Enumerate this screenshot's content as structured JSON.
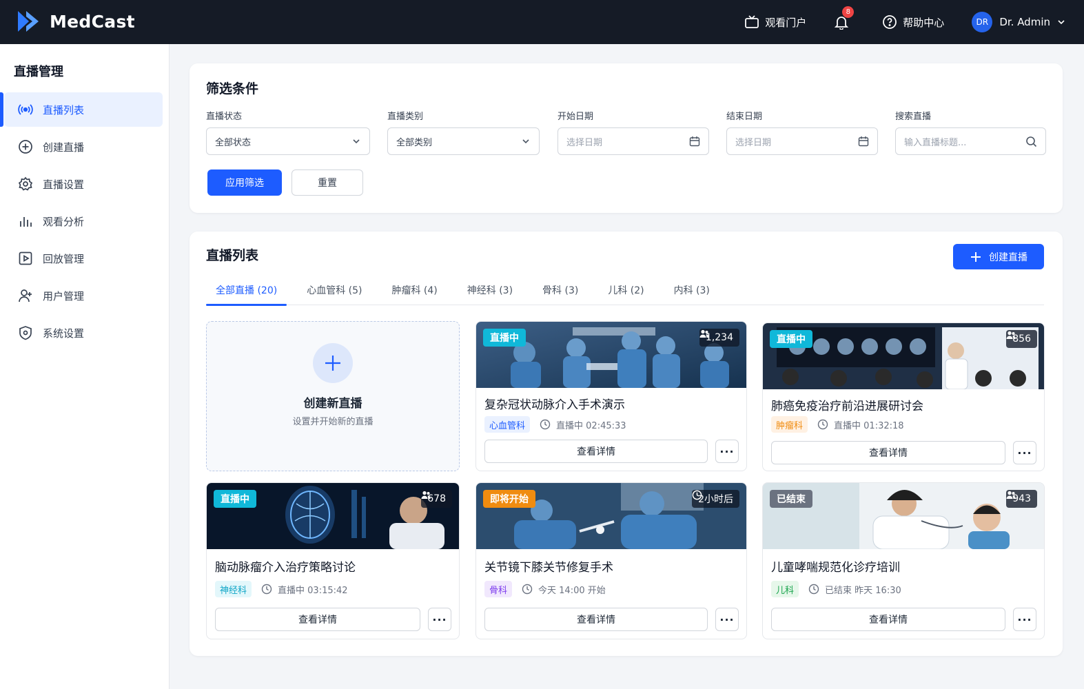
{
  "app": {
    "name": "MedCast"
  },
  "topbar": {
    "portal": "观看门户",
    "notifications": "8",
    "help": "帮助中心",
    "avatar": "DR",
    "user": "Dr. Admin"
  },
  "sidebar": {
    "title": "直播管理",
    "items": [
      {
        "label": "直播列表"
      },
      {
        "label": "创建直播"
      },
      {
        "label": "直播设置"
      },
      {
        "label": "观看分析"
      },
      {
        "label": "回放管理"
      },
      {
        "label": "用户管理"
      },
      {
        "label": "系统设置"
      }
    ]
  },
  "filters": {
    "title": "筛选条件",
    "status_label": "直播状态",
    "status_value": "全部状态",
    "category_label": "直播类别",
    "category_value": "全部类别",
    "start_label": "开始日期",
    "start_placeholder": "选择日期",
    "end_label": "结束日期",
    "end_placeholder": "选择日期",
    "search_label": "搜索直播",
    "search_placeholder": "输入直播标题...",
    "apply": "应用筛选",
    "reset": "重置"
  },
  "list": {
    "title": "直播列表",
    "create_button": "创建直播",
    "tabs": [
      {
        "label": "全部直播 (20)"
      },
      {
        "label": "心血管科 (5)"
      },
      {
        "label": "肿瘤科 (4)"
      },
      {
        "label": "神经科 (3)"
      },
      {
        "label": "骨科 (3)"
      },
      {
        "label": "儿科 (2)"
      },
      {
        "label": "内科 (3)"
      }
    ],
    "create_tile": {
      "title": "创建新直播",
      "subtitle": "设置并开始新的直播"
    },
    "detail_label": "查看详情",
    "more_label": "···",
    "streams": [
      {
        "status": "直播中",
        "viewers": "1,234",
        "title": "复杂冠状动脉介入手术演示",
        "dept": "心血管科",
        "time": "直播中 02:45:33"
      },
      {
        "status": "直播中",
        "viewers": "856",
        "title": "肺癌免疫治疗前沿进展研讨会",
        "dept": "肿瘤科",
        "time": "直播中 01:32:18"
      },
      {
        "status": "直播中",
        "viewers": "678",
        "title": "脑动脉瘤介入治疗策略讨论",
        "dept": "神经科",
        "time": "直播中 03:15:42"
      },
      {
        "status": "即将开始",
        "viewers": "2小时后",
        "title": "关节镜下膝关节修复手术",
        "dept": "骨科",
        "time": "今天 14:00 开始"
      },
      {
        "status": "已结束",
        "viewers": "943",
        "title": "儿童哮喘规范化诊疗培训",
        "dept": "儿科",
        "time": "已结束 昨天 16:30"
      }
    ]
  },
  "colors": {
    "primary": "#1d5cff",
    "topbar": "#151b26",
    "live": "#10b8d9",
    "upcoming": "#f08c10",
    "ended": "#6b7280"
  }
}
